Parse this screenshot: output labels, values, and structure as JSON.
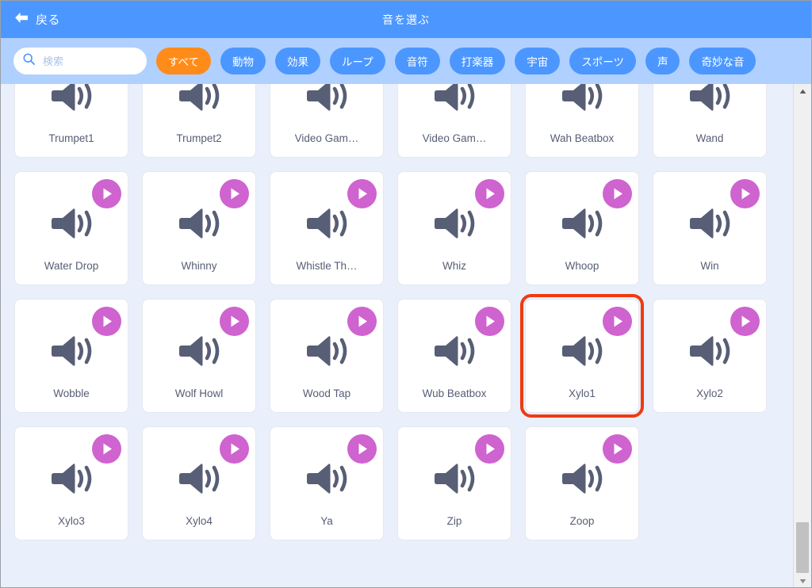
{
  "header": {
    "back_label": "戻る",
    "title": "音を選ぶ",
    "back_icon": "arrow-left-icon",
    "bg_color": "#4c97ff"
  },
  "search": {
    "placeholder": "検索",
    "value": "",
    "icon": "search-icon"
  },
  "filters": {
    "selected": "すべて",
    "selected_color": "#ff8c1a",
    "default_color": "#4c97ff",
    "tags": [
      {
        "label": "すべて",
        "selected": true
      },
      {
        "label": "動物",
        "selected": false
      },
      {
        "label": "効果",
        "selected": false
      },
      {
        "label": "ループ",
        "selected": false
      },
      {
        "label": "音符",
        "selected": false
      },
      {
        "label": "打楽器",
        "selected": false
      },
      {
        "label": "宇宙",
        "selected": false
      },
      {
        "label": "スポーツ",
        "selected": false
      },
      {
        "label": "声",
        "selected": false
      },
      {
        "label": "奇妙な音",
        "selected": false
      }
    ]
  },
  "grid": {
    "icon": "speaker-icon",
    "play_icon": "play-icon",
    "play_color": "#cf63cf",
    "highlight_color": "#ee3b10",
    "items": [
      {
        "label": "Trumpet1",
        "highlighted": false
      },
      {
        "label": "Trumpet2",
        "highlighted": false
      },
      {
        "label": "Video Gam…",
        "highlighted": false
      },
      {
        "label": "Video Gam…",
        "highlighted": false
      },
      {
        "label": "Wah Beatbox",
        "highlighted": false
      },
      {
        "label": "Wand",
        "highlighted": false
      },
      {
        "label": "Water Drop",
        "highlighted": false
      },
      {
        "label": "Whinny",
        "highlighted": false
      },
      {
        "label": "Whistle Th…",
        "highlighted": false
      },
      {
        "label": "Whiz",
        "highlighted": false
      },
      {
        "label": "Whoop",
        "highlighted": false
      },
      {
        "label": "Win",
        "highlighted": false
      },
      {
        "label": "Wobble",
        "highlighted": false
      },
      {
        "label": "Wolf Howl",
        "highlighted": false
      },
      {
        "label": "Wood Tap",
        "highlighted": false
      },
      {
        "label": "Wub Beatbox",
        "highlighted": false
      },
      {
        "label": "Xylo1",
        "highlighted": true
      },
      {
        "label": "Xylo2",
        "highlighted": false
      },
      {
        "label": "Xylo3",
        "highlighted": false
      },
      {
        "label": "Xylo4",
        "highlighted": false
      },
      {
        "label": "Ya",
        "highlighted": false
      },
      {
        "label": "Zip",
        "highlighted": false
      },
      {
        "label": "Zoop",
        "highlighted": false
      }
    ]
  },
  "scrollbar": {
    "up_icon": "triangle-up-icon",
    "down_icon": "triangle-down-icon",
    "thumb": "scrollbar-thumb"
  }
}
